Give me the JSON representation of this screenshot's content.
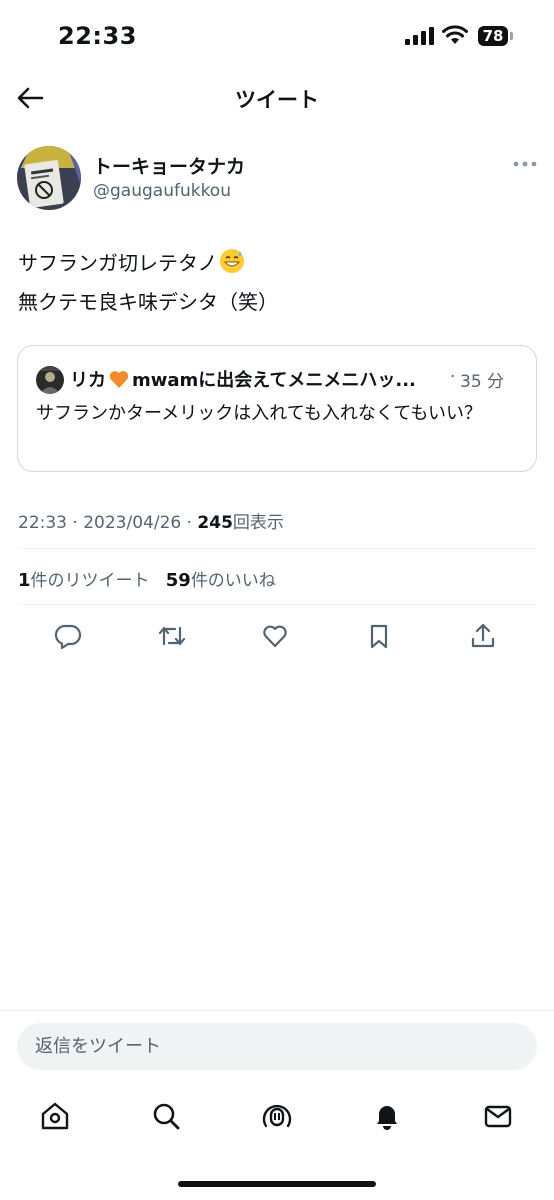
{
  "status_bar": {
    "time": "22:33",
    "battery": "78",
    "icons": [
      "signal-icon",
      "wifi-icon",
      "battery-icon"
    ]
  },
  "header": {
    "title": "ツイート",
    "back_icon": "arrow-left-icon"
  },
  "tweet": {
    "author_name": "トーキョータナカ",
    "author_handle": "@gaugaufukkou",
    "text_line1": "サフランガ切レテタノ",
    "text_line1_emoji": "grinning-sweat-emoji",
    "text_line2": "無クテモ良キ味デシタ（笑）",
    "quoted": {
      "author_name": "リカ",
      "author_name_emoji": "orange-heart-emoji",
      "author_name_rest": "mwamに出会えてメニメニハッ...",
      "separator": "·",
      "time": "35 分",
      "text": "サフランかターメリックは入れても入れなくてもいい？"
    },
    "meta": {
      "time": "22:33",
      "dot1": "·",
      "date": "2023/04/26",
      "dot2": "·",
      "views": "245",
      "views_label": "回表示"
    },
    "stats": {
      "retweets": "1",
      "retweets_label": "件のリツイート",
      "likes": "59",
      "likes_label": "件のいいね"
    },
    "actions": [
      "reply-icon",
      "retweet-icon",
      "like-icon",
      "bookmark-icon",
      "share-icon"
    ]
  },
  "reply": {
    "placeholder": "返信をツイート"
  },
  "tab_bar": {
    "tabs": [
      "home-icon",
      "search-icon",
      "spaces-icon",
      "notifications-icon",
      "messages-icon"
    ]
  },
  "colors": {
    "text": "#0f1419",
    "secondary": "#536471",
    "border": "#cfd9de",
    "input_bg": "#eff3f4",
    "heart": "#f28c28"
  }
}
